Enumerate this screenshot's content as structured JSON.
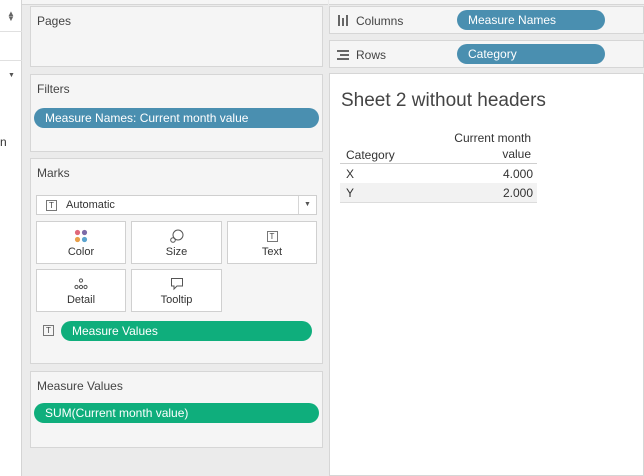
{
  "pages": {
    "title": "Pages"
  },
  "filters": {
    "title": "Filters",
    "pill": "Measure Names: Current month value"
  },
  "marks": {
    "title": "Marks",
    "mark_type": "Automatic",
    "buttons": [
      {
        "label": "Color",
        "icon": "color-dots-icon"
      },
      {
        "label": "Size",
        "icon": "size-icon"
      },
      {
        "label": "Text",
        "icon": "text-icon"
      },
      {
        "label": "Detail",
        "icon": "detail-icon"
      },
      {
        "label": "Tooltip",
        "icon": "tooltip-icon"
      }
    ],
    "text_pill": "Measure Values"
  },
  "measure_values": {
    "title": "Measure Values",
    "pill": "SUM(Current month value)"
  },
  "columns": {
    "label": "Columns",
    "pill": "Measure Names"
  },
  "rows": {
    "label": "Rows",
    "pill": "Category"
  },
  "sheet": {
    "title": "Sheet 2 without headers",
    "row_header": "Category",
    "measure_header_line1": "Current month",
    "measure_header_line2": "value",
    "rows": [
      {
        "category": "X",
        "value": "4.000"
      },
      {
        "category": "Y",
        "value": "2.000"
      }
    ]
  },
  "left_strip": {
    "cut_text": "n"
  },
  "colors": {
    "dimension_pill": "#4a8fb0",
    "measure_pill": "#0fae7c"
  }
}
